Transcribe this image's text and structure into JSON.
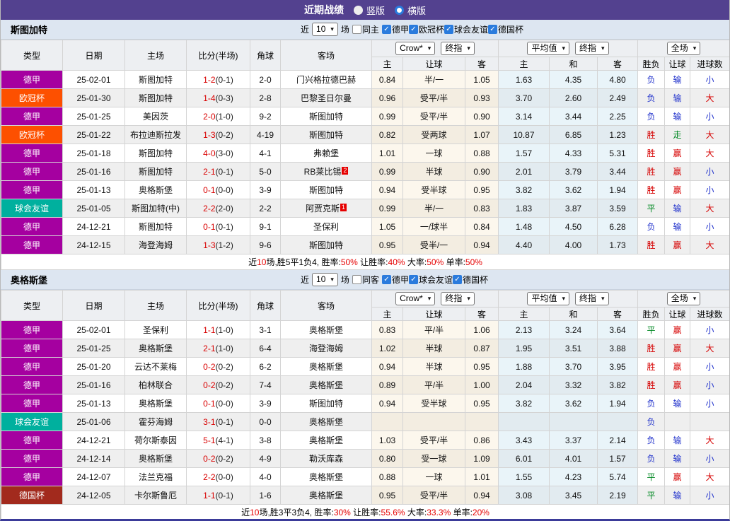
{
  "topbar": {
    "title": "近期战绩",
    "radios": [
      {
        "label": "竖版",
        "checked": false
      },
      {
        "label": "横版",
        "checked": true
      }
    ]
  },
  "columns": {
    "type": "类型",
    "date": "日期",
    "home": "主场",
    "score": "比分(半场)",
    "corner": "角球",
    "away": "客场",
    "sub": [
      "主",
      "让球",
      "客",
      "主",
      "和",
      "客",
      "胜负",
      "让球",
      "进球数"
    ]
  },
  "header_selects": {
    "book": "Crow*",
    "book_final": "终指",
    "avg": "平均值",
    "avg_final": "终指",
    "scope": "全场"
  },
  "league_colors": {
    "德甲": "#a500a0",
    "欧冠杯": "#fd5000",
    "球会友谊": "#00b09e",
    "德国杯": "#a22a1d"
  },
  "result_colors": {
    "胜": "#d60000",
    "平": "#008822",
    "负": "#2233cc",
    "赢": "#d60000",
    "走": "#008822",
    "输": "#2233cc",
    "大": "#d60000",
    "小": "#2233cc"
  },
  "accent": {
    "topbar": "#53418f",
    "section_bar": "#dde6f1",
    "check_blue": "#2a7bdd",
    "team_green": "#2e9e2e",
    "score_red": "#d90000"
  },
  "sections": [
    {
      "team": "斯图加特",
      "filter": {
        "near": "近",
        "games": "10",
        "unit": "场",
        "same": "同主",
        "leagues": [
          "德甲",
          "欧冠杯",
          "球会友谊",
          "德国杯"
        ]
      },
      "rows": [
        {
          "league": "德甲",
          "date": "25-02-01",
          "home": "斯图加特",
          "home_green": true,
          "score": "1-2",
          "half": "(0-1)",
          "corner": "2-0",
          "away": "门兴格拉德巴赫",
          "away_green": false,
          "away_badge": "",
          "crow": [
            "0.84",
            "半/一",
            "1.05"
          ],
          "avg": [
            "1.63",
            "4.35",
            "4.80"
          ],
          "res": [
            "负",
            "输",
            "小"
          ]
        },
        {
          "league": "欧冠杯",
          "date": "25-01-30",
          "home": "斯图加特",
          "home_green": true,
          "score": "1-4",
          "half": "(0-3)",
          "corner": "2-8",
          "away": "巴黎圣日尔曼",
          "away_green": false,
          "away_badge": "",
          "crow": [
            "0.96",
            "受平/半",
            "0.93"
          ],
          "avg": [
            "3.70",
            "2.60",
            "2.49"
          ],
          "res": [
            "负",
            "输",
            "大"
          ]
        },
        {
          "league": "德甲",
          "date": "25-01-25",
          "home": "美因茨",
          "home_green": false,
          "score": "2-0",
          "half": "(1-0)",
          "corner": "9-2",
          "away": "斯图加特",
          "away_green": true,
          "away_badge": "",
          "crow": [
            "0.99",
            "受平/半",
            "0.90"
          ],
          "avg": [
            "3.14",
            "3.44",
            "2.25"
          ],
          "res": [
            "负",
            "输",
            "小"
          ]
        },
        {
          "league": "欧冠杯",
          "date": "25-01-22",
          "home": "布拉迪斯拉发",
          "home_green": false,
          "score": "1-3",
          "half": "(0-2)",
          "corner": "4-19",
          "away": "斯图加特",
          "away_green": true,
          "away_badge": "",
          "crow": [
            "0.82",
            "受两球",
            "1.07"
          ],
          "avg": [
            "10.87",
            "6.85",
            "1.23"
          ],
          "res": [
            "胜",
            "走",
            "大"
          ]
        },
        {
          "league": "德甲",
          "date": "25-01-18",
          "home": "斯图加特",
          "home_green": true,
          "score": "4-0",
          "half": "(3-0)",
          "corner": "4-1",
          "away": "弗赖堡",
          "away_green": false,
          "away_badge": "",
          "crow": [
            "1.01",
            "一球",
            "0.88"
          ],
          "avg": [
            "1.57",
            "4.33",
            "5.31"
          ],
          "res": [
            "胜",
            "赢",
            "大"
          ]
        },
        {
          "league": "德甲",
          "date": "25-01-16",
          "home": "斯图加特",
          "home_green": true,
          "score": "2-1",
          "half": "(0-1)",
          "corner": "5-0",
          "away": "RB莱比锡",
          "away_green": false,
          "away_badge": "2",
          "crow": [
            "0.99",
            "半球",
            "0.90"
          ],
          "avg": [
            "2.01",
            "3.79",
            "3.44"
          ],
          "res": [
            "胜",
            "赢",
            "小"
          ]
        },
        {
          "league": "德甲",
          "date": "25-01-13",
          "home": "奥格斯堡",
          "home_green": false,
          "score": "0-1",
          "half": "(0-0)",
          "corner": "3-9",
          "away": "斯图加特",
          "away_green": true,
          "away_badge": "",
          "crow": [
            "0.94",
            "受半球",
            "0.95"
          ],
          "avg": [
            "3.82",
            "3.62",
            "1.94"
          ],
          "res": [
            "胜",
            "赢",
            "小"
          ]
        },
        {
          "league": "球会友谊",
          "date": "25-01-05",
          "home": "斯图加特(中)",
          "home_green": true,
          "score": "2-2",
          "half": "(2-0)",
          "corner": "2-2",
          "away": "阿贾克斯",
          "away_green": false,
          "away_badge": "1",
          "crow": [
            "0.99",
            "半/一",
            "0.83"
          ],
          "avg": [
            "1.83",
            "3.87",
            "3.59"
          ],
          "res": [
            "平",
            "输",
            "大"
          ]
        },
        {
          "league": "德甲",
          "date": "24-12-21",
          "home": "斯图加特",
          "home_green": true,
          "score": "0-1",
          "half": "(0-1)",
          "corner": "9-1",
          "away": "圣保利",
          "away_green": false,
          "away_badge": "",
          "crow": [
            "1.05",
            "一/球半",
            "0.84"
          ],
          "avg": [
            "1.48",
            "4.50",
            "6.28"
          ],
          "res": [
            "负",
            "输",
            "小"
          ]
        },
        {
          "league": "德甲",
          "date": "24-12-15",
          "home": "海登海姆",
          "home_green": false,
          "score": "1-3",
          "half": "(1-2)",
          "corner": "9-6",
          "away": "斯图加特",
          "away_green": true,
          "away_badge": "",
          "crow": [
            "0.95",
            "受半/一",
            "0.94"
          ],
          "avg": [
            "4.40",
            "4.00",
            "1.73"
          ],
          "res": [
            "胜",
            "赢",
            "大"
          ]
        }
      ],
      "summary": [
        {
          "t": "近"
        },
        {
          "t": "10",
          "red": true
        },
        {
          "t": "场,胜5平1负4, 胜率:"
        },
        {
          "t": "50%",
          "red": true
        },
        {
          "t": " 让胜率:"
        },
        {
          "t": "40%",
          "red": true
        },
        {
          "t": " 大率:"
        },
        {
          "t": "50%",
          "red": true
        },
        {
          "t": " 单率:"
        },
        {
          "t": "50%",
          "red": true
        }
      ]
    },
    {
      "team": "奥格斯堡",
      "filter": {
        "near": "近",
        "games": "10",
        "unit": "场",
        "same": "同客",
        "leagues": [
          "德甲",
          "球会友谊",
          "德国杯"
        ]
      },
      "rows": [
        {
          "league": "德甲",
          "date": "25-02-01",
          "home": "圣保利",
          "home_green": false,
          "score": "1-1",
          "half": "(1-0)",
          "corner": "3-1",
          "away": "奥格斯堡",
          "away_green": true,
          "away_badge": "",
          "crow": [
            "0.83",
            "平/半",
            "1.06"
          ],
          "avg": [
            "2.13",
            "3.24",
            "3.64"
          ],
          "res": [
            "平",
            "赢",
            "小"
          ]
        },
        {
          "league": "德甲",
          "date": "25-01-25",
          "home": "奥格斯堡",
          "home_green": true,
          "score": "2-1",
          "half": "(1-0)",
          "corner": "6-4",
          "away": "海登海姆",
          "away_green": false,
          "away_badge": "",
          "crow": [
            "1.02",
            "半球",
            "0.87"
          ],
          "avg": [
            "1.95",
            "3.51",
            "3.88"
          ],
          "res": [
            "胜",
            "赢",
            "大"
          ]
        },
        {
          "league": "德甲",
          "date": "25-01-20",
          "home": "云达不莱梅",
          "home_green": false,
          "score": "0-2",
          "half": "(0-2)",
          "corner": "6-2",
          "away": "奥格斯堡",
          "away_green": true,
          "away_badge": "",
          "crow": [
            "0.94",
            "半球",
            "0.95"
          ],
          "avg": [
            "1.88",
            "3.70",
            "3.95"
          ],
          "res": [
            "胜",
            "赢",
            "小"
          ]
        },
        {
          "league": "德甲",
          "date": "25-01-16",
          "home": "柏林联合",
          "home_green": false,
          "score": "0-2",
          "half": "(0-2)",
          "corner": "7-4",
          "away": "奥格斯堡",
          "away_green": true,
          "away_badge": "",
          "crow": [
            "0.89",
            "平/半",
            "1.00"
          ],
          "avg": [
            "2.04",
            "3.32",
            "3.82"
          ],
          "res": [
            "胜",
            "赢",
            "小"
          ]
        },
        {
          "league": "德甲",
          "date": "25-01-13",
          "home": "奥格斯堡",
          "home_green": true,
          "score": "0-1",
          "half": "(0-0)",
          "corner": "3-9",
          "away": "斯图加特",
          "away_green": false,
          "away_badge": "",
          "crow": [
            "0.94",
            "受半球",
            "0.95"
          ],
          "avg": [
            "3.82",
            "3.62",
            "1.94"
          ],
          "res": [
            "负",
            "输",
            "小"
          ]
        },
        {
          "league": "球会友谊",
          "date": "25-01-06",
          "home": "霍芬海姆",
          "home_green": false,
          "score": "3-1",
          "half": "(0-1)",
          "corner": "0-0",
          "away": "奥格斯堡",
          "away_green": true,
          "away_badge": "",
          "crow": [
            "",
            "",
            ""
          ],
          "avg": [
            "",
            "",
            ""
          ],
          "res": [
            "负",
            "",
            ""
          ]
        },
        {
          "league": "德甲",
          "date": "24-12-21",
          "home": "荷尔斯泰因",
          "home_green": false,
          "score": "5-1",
          "half": "(4-1)",
          "corner": "3-8",
          "away": "奥格斯堡",
          "away_green": true,
          "away_badge": "",
          "crow": [
            "1.03",
            "受平/半",
            "0.86"
          ],
          "avg": [
            "3.43",
            "3.37",
            "2.14"
          ],
          "res": [
            "负",
            "输",
            "大"
          ]
        },
        {
          "league": "德甲",
          "date": "24-12-14",
          "home": "奥格斯堡",
          "home_green": true,
          "score": "0-2",
          "half": "(0-2)",
          "corner": "4-9",
          "away": "勒沃库森",
          "away_green": false,
          "away_badge": "",
          "crow": [
            "0.80",
            "受一球",
            "1.09"
          ],
          "avg": [
            "6.01",
            "4.01",
            "1.57"
          ],
          "res": [
            "负",
            "输",
            "小"
          ]
        },
        {
          "league": "德甲",
          "date": "24-12-07",
          "home": "法兰克福",
          "home_green": false,
          "score": "2-2",
          "half": "(0-0)",
          "corner": "4-0",
          "away": "奥格斯堡",
          "away_green": true,
          "away_badge": "",
          "crow": [
            "0.88",
            "一球",
            "1.01"
          ],
          "avg": [
            "1.55",
            "4.23",
            "5.74"
          ],
          "res": [
            "平",
            "赢",
            "大"
          ]
        },
        {
          "league": "德国杯",
          "date": "24-12-05",
          "home": "卡尔斯鲁厄",
          "home_green": false,
          "score": "1-1",
          "half": "(0-1)",
          "corner": "1-6",
          "away": "奥格斯堡",
          "away_green": true,
          "away_badge": "",
          "crow": [
            "0.95",
            "受平/半",
            "0.94"
          ],
          "avg": [
            "3.08",
            "3.45",
            "2.19"
          ],
          "res": [
            "平",
            "输",
            "小"
          ]
        }
      ],
      "summary": [
        {
          "t": "近"
        },
        {
          "t": "10",
          "red": true
        },
        {
          "t": "场,胜3平3负4, 胜率:"
        },
        {
          "t": "30%",
          "red": true
        },
        {
          "t": " 让胜率:"
        },
        {
          "t": "55.6%",
          "red": true
        },
        {
          "t": " 大率:"
        },
        {
          "t": "33.3%",
          "red": true
        },
        {
          "t": " 单率:"
        },
        {
          "t": "20%",
          "red": true
        }
      ]
    }
  ]
}
